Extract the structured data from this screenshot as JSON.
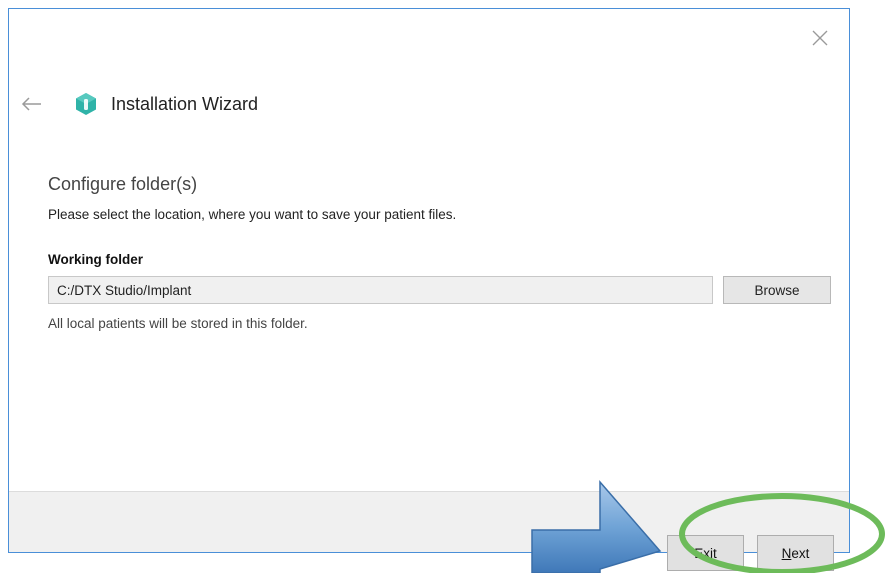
{
  "window": {
    "close_icon": "close-icon",
    "back_icon": "back-arrow-icon",
    "logo_icon": "app-logo-icon",
    "title": "Installation Wizard"
  },
  "step": {
    "title": "Configure folder(s)",
    "description": "Please select the location, where you want to save your patient files."
  },
  "working_folder": {
    "label": "Working folder",
    "value": "C:/DTX Studio/Implant",
    "browse_label": "Browse",
    "help": "All local patients will be stored in this folder."
  },
  "footer": {
    "exit_label": "Exit",
    "next_mnemonic": "N",
    "next_rest": "ext"
  },
  "colors": {
    "window_border": "#4a8fd8",
    "logo_teal": "#2fb3a8",
    "annotation_arrow": "#6aa0d4",
    "annotation_circle": "#6dbb5a"
  }
}
